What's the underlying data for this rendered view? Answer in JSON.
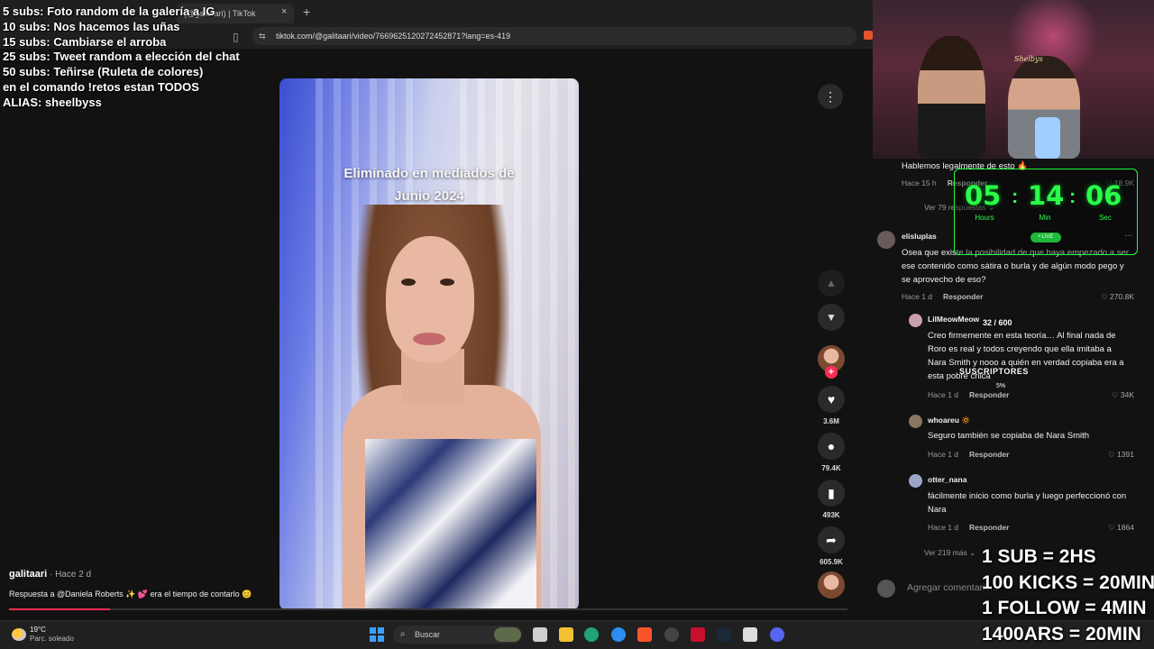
{
  "browser": {
    "tab_title": "(@galitaari) | TikTok",
    "new_tab": "+",
    "tab_close": "×",
    "url": "tiktok.com/@galitaari/video/7669625120272452871?lang=es-419"
  },
  "overlay": {
    "goals": [
      "5 subs: Foto random de la galería a IG",
      "10 subs: Nos hacemos las uñas",
      "15 subs: Cambiarse el arroba",
      "25 subs: Tweet random a elección del chat",
      "50 subs: Teñirse (Ruleta de colores)",
      "en el comando !retos estan TODOS",
      "ALIAS: sheelbyss"
    ],
    "timer": {
      "hours": "05",
      "minutes": "14",
      "seconds": "06",
      "sep": ":",
      "hours_label": "Hours",
      "minutes_label": "Min",
      "seconds_label": "Sec",
      "live": "• LIVE"
    },
    "subs_goal": "32 / 600",
    "subs_label": "SUSCRIPTORES",
    "subs_percent": "5%",
    "rewards": [
      "1 SUB = 2HS",
      "100 KICKS = 20MIN",
      "1 FOLLOW = 4MIN",
      "1400ARS = 20MIN"
    ],
    "cam_logo": "Shelbys"
  },
  "video": {
    "caption": "Eliminado en mediados de\nJunio 2024",
    "author": "galitaari",
    "author_time": " · Hace 2 d",
    "description": "Respuesta a @Daniela Roberts ✨ 💕 era el tiempo de contarlo 😊",
    "progress": 0.12
  },
  "actions": {
    "more": "⋮",
    "up": "▲",
    "down": "▼",
    "follow": "+",
    "like_icon": "heart-icon",
    "likes": "3.6M",
    "comments": "79.4K",
    "saves": "493K",
    "shares": "605.9K"
  },
  "comments": {
    "c0": {
      "text": "Hablemos legalmente de esto 🔥",
      "time": "Hace 15 h",
      "reply": "Responder",
      "likes": "18.9K"
    },
    "c0_more": "Ver 79 respuestas ⌄",
    "c1": {
      "user": "elisluplas",
      "text": "Osea que existe la posibilidad de que haya empezado a ser ese contenido como sátira o burla y de algún modo pego y se aprovecho de eso?",
      "time": "Hace 1 d",
      "reply": "Responder",
      "likes": "270.8K",
      "menu": "···"
    },
    "r1": {
      "user": "LilMeowMeow",
      "text": "Creo firmemente en esta teoría… Al final nada de Roro es real y todos creyendo que ella imitaba a Nara Smith y nooo a quién en verdad copiaba era a esta pobre chica",
      "time": "Hace 1 d",
      "reply": "Responder",
      "likes": "34K"
    },
    "r2": {
      "user": "whoareu 🔅",
      "text": "Seguro también se copiaba de Nara Smith",
      "time": "Hace 1 d",
      "reply": "Responder",
      "likes": "1391"
    },
    "r3": {
      "user": "otter_nana",
      "text": "fácilmente inicio como burla y luego perfeccionó con Nara",
      "time": "Hace 1 d",
      "reply": "Responder",
      "likes": "1864"
    },
    "more_replies": "Ver 219 más ⌄",
    "input_placeholder": "Agregar comentario..."
  },
  "taskbar": {
    "temp": "19°C",
    "weather": "Parc. soleado",
    "search": "Buscar"
  },
  "colors": {
    "accent": "#fe2c55",
    "timer_green": "#29ff4a"
  }
}
